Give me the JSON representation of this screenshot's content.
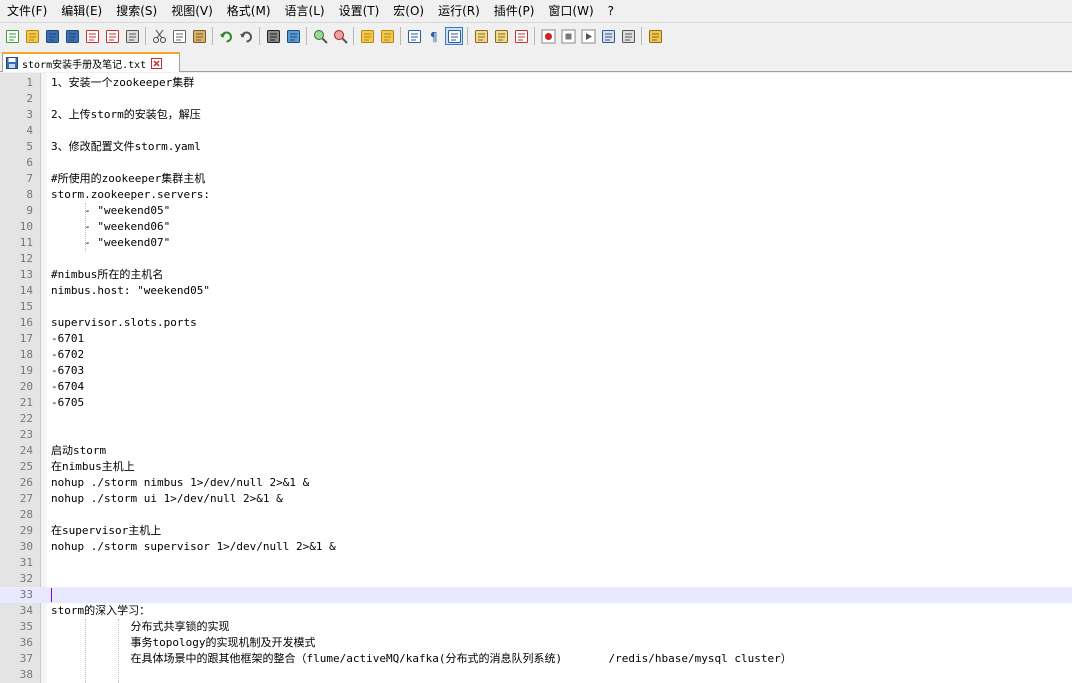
{
  "menu": [
    "文件(F)",
    "编辑(E)",
    "搜索(S)",
    "视图(V)",
    "格式(M)",
    "语言(L)",
    "设置(T)",
    "宏(O)",
    "运行(R)",
    "插件(P)",
    "窗口(W)",
    "?"
  ],
  "toolbar": {
    "icons": [
      "new-file-icon",
      "open-file-icon",
      "save-icon",
      "save-all-icon",
      "close-icon",
      "close-all-icon",
      "print-icon",
      "|",
      "cut-icon",
      "copy-icon",
      "paste-icon",
      "|",
      "undo-icon",
      "redo-icon",
      "|",
      "find-icon",
      "replace-icon",
      "|",
      "zoom-in-icon",
      "zoom-out-icon",
      "|",
      "sync-vertical-icon",
      "sync-horizontal-icon",
      "|",
      "word-wrap-icon",
      "show-all-chars-icon",
      "indent-guide-icon",
      "|",
      "document-map-icon",
      "function-list-icon",
      "folder-workspace-icon",
      "|",
      "record-macro-icon",
      "stop-record-icon",
      "play-macro-icon",
      "run-macro-multiple-icon",
      "save-macro-icon",
      "|",
      "launch-icon"
    ],
    "active_index": 26
  },
  "tab": {
    "label": "storm安装手册及笔记.txt"
  },
  "editor": {
    "current_line": 33,
    "lines": [
      "1、安装一个zookeeper集群",
      "",
      "2、上传storm的安装包，解压",
      "",
      "3、修改配置文件storm.yaml",
      "",
      "#所使用的zookeeper集群主机",
      "storm.zookeeper.servers:",
      "     - \"weekend05\"",
      "     - \"weekend06\"",
      "     - \"weekend07\"",
      "",
      "#nimbus所在的主机名",
      "nimbus.host: \"weekend05\"",
      "",
      "supervisor.slots.ports",
      "-6701",
      "-6702",
      "-6703",
      "-6704",
      "-6705",
      "",
      "",
      "启动storm",
      "在nimbus主机上",
      "nohup ./storm nimbus 1>/dev/null 2>&1 &",
      "nohup ./storm ui 1>/dev/null 2>&1 &",
      "",
      "在supervisor主机上",
      "nohup ./storm supervisor 1>/dev/null 2>&1 &",
      "",
      "",
      "",
      "storm的深入学习：",
      "            分布式共享锁的实现",
      "            事务topology的实现机制及开发模式",
      "            在具体场景中的跟其他框架的整合（flume/activeMQ/kafka(分布式的消息队列系统)       /redis/hbase/mysql cluster）",
      ""
    ]
  },
  "colors": {
    "accent": "#f5a623",
    "current_line": "#e8e8ff",
    "caret": "#8000ff",
    "gutter": "#e4e4e4"
  }
}
